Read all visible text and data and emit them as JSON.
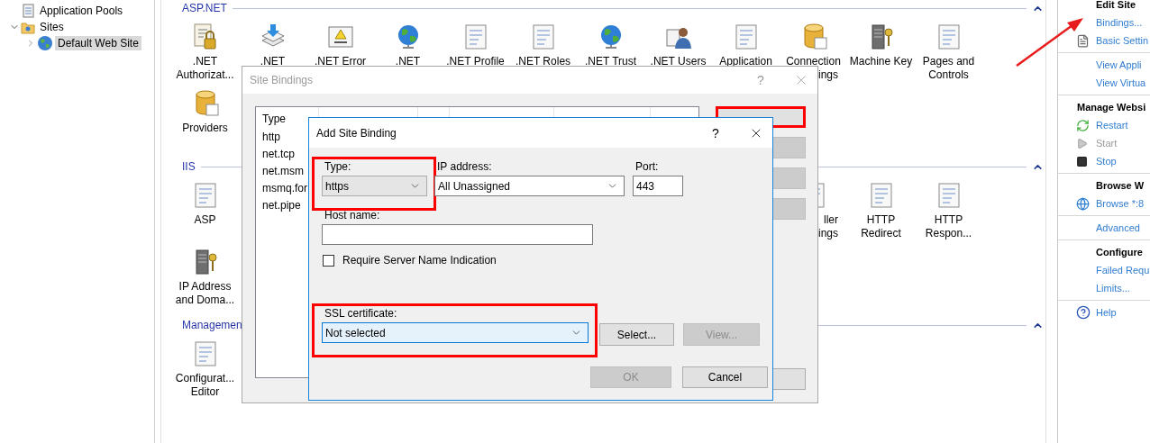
{
  "tree": [
    {
      "label": "Application Pools",
      "selected": false
    },
    {
      "label": "Sites",
      "selected": false,
      "expanded": true,
      "children": [
        {
          "label": "Default Web Site",
          "selected": true,
          "expanded": false
        }
      ]
    }
  ],
  "feature_groups": [
    {
      "title": "ASP.NET",
      "rows": [
        [
          {
            "lines": [
              {
                "text": ".NET",
                "cut": false
              },
              {
                "text": "Authorizat...",
                "cut": false
              }
            ]
          },
          {
            "lines": [
              {
                "text": ".NET",
                "cut": false
              }
            ]
          },
          {
            "lines": [
              {
                "text": ".NET Error",
                "cut": false
              }
            ]
          },
          {
            "lines": [
              {
                "text": ".NET",
                "cut": false
              }
            ]
          },
          {
            "lines": [
              {
                "text": ".NET Profile",
                "cut": false
              }
            ]
          },
          {
            "lines": [
              {
                "text": ".NET Roles",
                "cut": false
              }
            ]
          },
          {
            "lines": [
              {
                "text": ".NET Trust",
                "cut": false
              }
            ]
          },
          {
            "lines": [
              {
                "text": ".NET Users",
                "cut": false
              }
            ]
          },
          {
            "lines": [
              {
                "text": "Application",
                "cut": false
              }
            ]
          },
          {
            "lines": [
              {
                "text": "Connection",
                "cut": false
              },
              {
                "text": "ings",
                "cut": true
              }
            ]
          },
          {
            "lines": [
              {
                "text": "Machine Key",
                "cut": false
              }
            ]
          },
          {
            "lines": [
              {
                "text": "Pages and",
                "cut": false
              },
              {
                "text": "Controls",
                "cut": false
              }
            ]
          }
        ],
        [
          {
            "lines": [
              {
                "text": "Providers",
                "cut": false
              }
            ]
          }
        ]
      ]
    },
    {
      "title": "IIS",
      "rows": [
        [
          {
            "lines": [
              {
                "text": "ASP",
                "cut": false
              }
            ]
          },
          {
            "lines": [
              {
                "text": "ller",
                "cut": true
              },
              {
                "text": "ings",
                "cut": true
              }
            ]
          },
          {
            "lines": [
              {
                "text": "HTTP",
                "cut": false
              },
              {
                "text": "Redirect",
                "cut": false
              }
            ]
          },
          {
            "lines": [
              {
                "text": "HTTP",
                "cut": false
              },
              {
                "text": "Respon...",
                "cut": false
              }
            ]
          }
        ],
        [
          {
            "lines": [
              {
                "text": "IP Address",
                "cut": false
              },
              {
                "text": "and Doma...",
                "cut": false
              }
            ]
          }
        ]
      ]
    },
    {
      "title": "Managemen",
      "rows": [
        [
          {
            "lines": [
              {
                "text": "Configurat...",
                "cut": false
              },
              {
                "text": "Editor",
                "cut": false
              }
            ]
          }
        ]
      ]
    }
  ],
  "actions": {
    "sections": [
      {
        "title": "Edit Site",
        "kind": "subheading",
        "items": [
          {
            "label": "Bindings...",
            "disabled": false,
            "pointed_at": true
          },
          {
            "label": "Basic Settin",
            "disabled": false,
            "pointed_at": false
          }
        ]
      },
      {
        "items": [
          {
            "label": "View Appli",
            "disabled": false,
            "pointed_at": false
          },
          {
            "label": "View Virtua",
            "disabled": false,
            "pointed_at": false
          }
        ]
      },
      {
        "title": "Manage Websi",
        "kind": "heading",
        "items": [
          {
            "label": "Restart",
            "disabled": false,
            "pointed_at": false
          },
          {
            "label": "Start",
            "disabled": true,
            "pointed_at": false
          },
          {
            "label": "Stop",
            "disabled": false,
            "pointed_at": false
          }
        ]
      },
      {
        "title": "Browse W",
        "kind": "subheading",
        "items": [
          {
            "label": "Browse *:8",
            "disabled": false,
            "pointed_at": false
          }
        ]
      },
      {
        "items": [
          {
            "label": "Advanced",
            "disabled": false,
            "pointed_at": false
          }
        ]
      },
      {
        "title": "Configure",
        "kind": "subheading",
        "items": [
          {
            "label": "Failed Requ",
            "disabled": false,
            "pointed_at": false
          },
          {
            "label": "Limits...",
            "disabled": false,
            "pointed_at": false
          }
        ]
      },
      {
        "items": [
          {
            "label": "Help",
            "disabled": false,
            "pointed_at": false
          }
        ]
      }
    ]
  },
  "site_bindings": {
    "title": "Site Bindings",
    "active": false,
    "help_button": "?",
    "table": {
      "columns": [
        "Type"
      ],
      "rows": [
        "http",
        "net.tcp",
        "net.msm",
        "msmq.for",
        "net.pipe"
      ]
    },
    "buttons": [
      {
        "disabled": false,
        "highlighted": true
      },
      {
        "disabled": true,
        "highlighted": false
      },
      {
        "disabled": true,
        "highlighted": false
      },
      {
        "disabled": true,
        "highlighted": false
      },
      {
        "disabled": false,
        "highlighted": false
      }
    ]
  },
  "add_site_binding": {
    "title": "Add Site Binding",
    "active": true,
    "help_button": "?",
    "type": {
      "label": "Type:",
      "value": "https",
      "editable": false,
      "focused": false,
      "highlighted": true
    },
    "ip_address": {
      "label": "IP address:",
      "value": "All Unassigned",
      "editable": true,
      "focused": false
    },
    "port": {
      "label": "Port:",
      "value": "443"
    },
    "host_name": {
      "label": "Host name:"
    },
    "sni": {
      "label": "Require Server Name Indication",
      "checked": false
    },
    "ssl_certificate": {
      "label": "SSL certificate:",
      "value": "Not selected",
      "focused": true,
      "highlighted": true
    },
    "select_button": {
      "label": "Select...",
      "disabled": false
    },
    "view_button": {
      "label": "View...",
      "disabled": true
    },
    "ok_button": {
      "label": "OK",
      "disabled": true
    },
    "cancel_button": {
      "label": "Cancel",
      "disabled": false
    }
  }
}
